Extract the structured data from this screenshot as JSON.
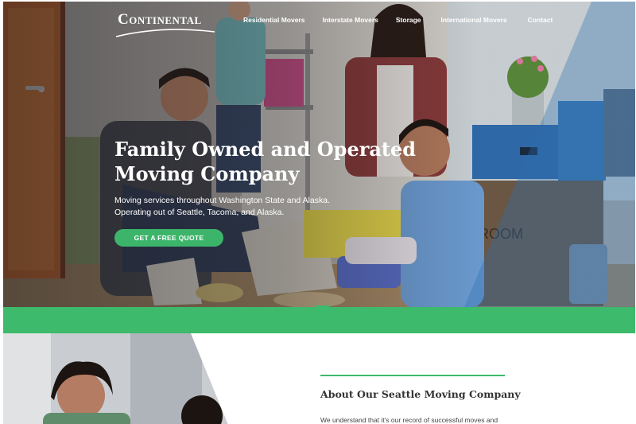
{
  "brand": {
    "logo_text": "Continental"
  },
  "nav": {
    "items": [
      {
        "label": "Residential Movers"
      },
      {
        "label": "Interstate Movers"
      },
      {
        "label": "Storage"
      },
      {
        "label": "International Movers"
      },
      {
        "label": "Contact"
      }
    ]
  },
  "hero": {
    "title_line1": "Family Owned and Operated",
    "title_line2": "Moving Company",
    "subtitle_line1": "Moving services throughout Washington State and Alaska.",
    "subtitle_line2": "Operating out of Seattle, Tacoma, and Alaska.",
    "cta_label": "GET A FREE QUOTE"
  },
  "about": {
    "title": "About Our Seattle Moving Company",
    "text": "We understand that it's our record of successful moves and"
  },
  "colors": {
    "accent_green": "#3dba6b",
    "button_green": "#3cb56a",
    "overlay_blue": "#2e6fb3"
  }
}
